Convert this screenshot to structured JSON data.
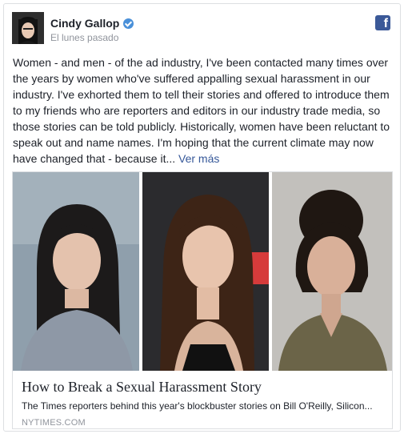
{
  "post": {
    "author": "Cindy Gallop",
    "timestamp": "El lunes pasado",
    "text": "Women - and men - of the ad industry, I've been contacted many times over the years by women who've suffered appalling sexual harassment in our industry. I've exhorted them to tell their stories and offered to introduce them to my friends who are reporters and editors in our industry trade media, so those stories can be told publicly. Historically, women have been reluctant to speak out and name names. I'm hoping that the current climate may now have changed that - because it...",
    "see_more": "Ver más",
    "platform_icon": "facebook-icon"
  },
  "link_card": {
    "title": "How to Break a Sexual Harassment Story",
    "description": "The Times reporters behind this year's blockbuster stories on Bill O'Reilly, Silicon...",
    "domain": "NYTIMES.COM"
  },
  "colors": {
    "link": "#365899",
    "facebook_blue": "#3b5998",
    "verified": "#4a90d9",
    "muted": "#90949c"
  }
}
